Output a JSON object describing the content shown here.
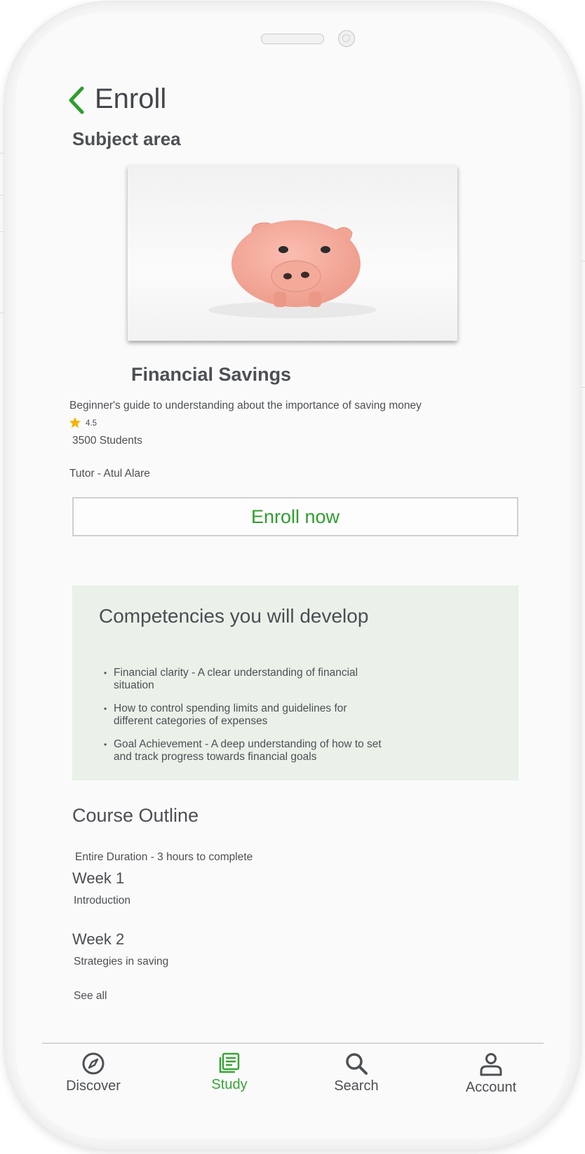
{
  "header": {
    "title": "Enroll",
    "section_label": "Subject area"
  },
  "course": {
    "image_subject": "piggy-bank",
    "title": "Financial Savings",
    "description": "Beginner's guide to  understanding  about the importance of saving money",
    "rating": "4.5",
    "students": "3500 Students",
    "tutor": "Tutor -  Atul Alare",
    "enroll_button": "Enroll now"
  },
  "competencies": {
    "title": "Competencies you will develop",
    "items": [
      "Financial clarity - A  clear understanding of financial situation",
      "How to control spending limits and guidelines for different categories of expenses",
      "Goal Achievement -  A deep understanding of how to set and track progress towards financial goals"
    ]
  },
  "outline": {
    "title": "Course Outline",
    "duration": "Entire Duration - 3 hours to complete",
    "weeks": [
      {
        "title": "Week 1",
        "topic": "Introduction"
      },
      {
        "title": "Week 2",
        "topic": "Strategies in saving"
      }
    ],
    "see_all": "See all"
  },
  "nav": {
    "items": [
      {
        "label": "Discover",
        "icon": "compass-icon"
      },
      {
        "label": "Study",
        "icon": "study-icon",
        "active": true
      },
      {
        "label": "Search",
        "icon": "search-icon"
      },
      {
        "label": "Account",
        "icon": "account-icon"
      }
    ]
  },
  "colors": {
    "accent": "#36a536",
    "competency_bg": "#e9f1e9",
    "star": "#f5b400"
  }
}
